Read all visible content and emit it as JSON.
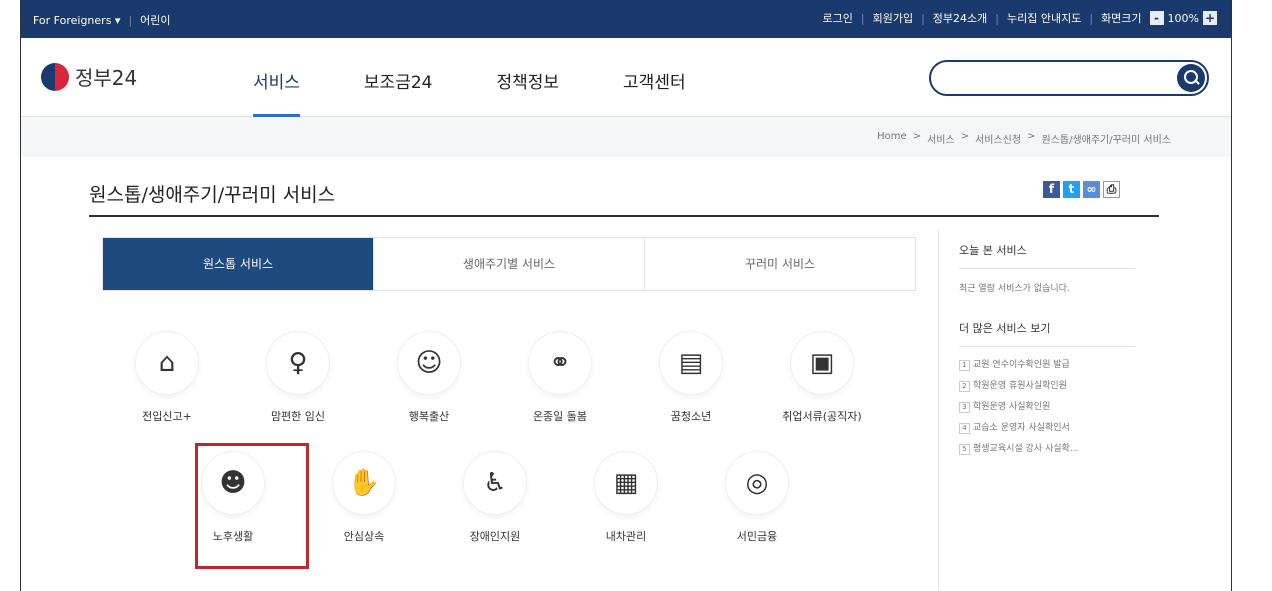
{
  "topbar": {
    "for_foreigners": "For Foreigners ▾",
    "kids": "어린이",
    "links": [
      "로그인",
      "회원가입",
      "정부24소개",
      "누리집 안내지도"
    ],
    "screen_size_label": "화면크기",
    "zoom_minus": "-",
    "zoom_value": "100%",
    "zoom_plus": "+"
  },
  "header": {
    "logo_text": "정부24",
    "nav": [
      "서비스",
      "보조금24",
      "정책정보",
      "고객센터"
    ],
    "search_placeholder": ""
  },
  "breadcrumb": [
    "Home",
    ">",
    "서비스",
    ">",
    "서비스신청",
    ">",
    "원스톱/생애주기/꾸러미 서비스"
  ],
  "page_title": "원스톱/생애주기/꾸러미 서비스",
  "tabs": [
    "원스톱 서비스",
    "생애주기별 서비스",
    "꾸러미 서비스"
  ],
  "services_row1": [
    {
      "label": "전입신고+",
      "icon": "house-icon"
    },
    {
      "label": "맘편한 임신",
      "icon": "pregnancy-icon"
    },
    {
      "label": "행복출산",
      "icon": "baby-icon"
    },
    {
      "label": "온종일 돌봄",
      "icon": "ribbon-icon"
    },
    {
      "label": "꿈청소년",
      "icon": "book-icon"
    },
    {
      "label": "취업서류(공직자)",
      "icon": "briefcase-icon"
    }
  ],
  "services_row2": [
    {
      "label": "노후생활",
      "icon": "elder-icon"
    },
    {
      "label": "안심상속",
      "icon": "hands-icon"
    },
    {
      "label": "장애인지원",
      "icon": "wheelchair-icon"
    },
    {
      "label": "내차관리",
      "icon": "car-doc-icon"
    },
    {
      "label": "서민금융",
      "icon": "coins-icon"
    }
  ],
  "sidebar": {
    "recent_title": "오늘 본 서비스",
    "recent_empty": "최근 열람 서비스가 없습니다.",
    "more_title": "더 많은 서비스 보기",
    "more_items": [
      "교원 연수이수확인원 발급",
      "학원운영 휴원사실확인원",
      "학원운영 사실확인원",
      "교습소 운영자 사실확인서",
      "평생교육시설 강사 사실확..."
    ]
  },
  "colors": {
    "navy": "#1a3a6e",
    "highlight": "#c0262e"
  }
}
